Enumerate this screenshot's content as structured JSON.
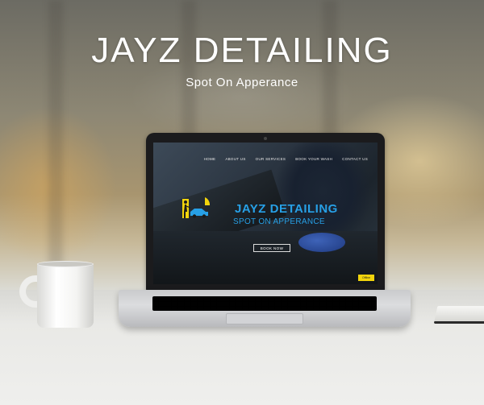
{
  "hero": {
    "title": "JAYZ DETAILING",
    "subtitle": "Spot On Apperance"
  },
  "screen": {
    "nav": [
      "HOME",
      "ABOUT US",
      "OUR SERVICES",
      "BOOK YOUR WASH",
      "CONTACT US"
    ],
    "brand": "JAYZ DETAILING",
    "tagline": "SPOT ON APPERANCE",
    "cta": "BOOK NOW",
    "badge": "Offline"
  },
  "colors": {
    "brand_blue": "#27a0e6",
    "logo_yellow": "#f2d40c",
    "hero_text": "#ffffff"
  },
  "icons": [
    "person-with-pressure-washer-icon",
    "car-icon"
  ]
}
